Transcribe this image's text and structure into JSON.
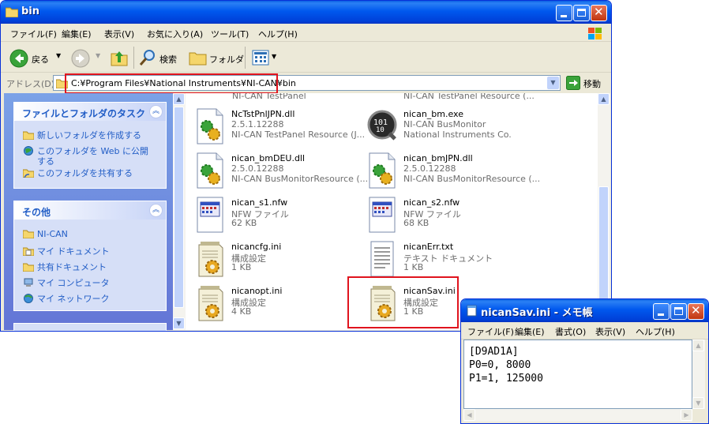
{
  "explorer": {
    "title": "bin",
    "menu": [
      "ファイル(F)",
      "編集(E)",
      "表示(V)",
      "お気に入り(A)",
      "ツール(T)",
      "ヘルプ(H)"
    ],
    "toolbar": {
      "back_label": "戻る",
      "search_label": "検索",
      "folders_label": "フォルダ"
    },
    "address": {
      "label": "アドレス(D)",
      "value": "C:¥Program Files¥National Instruments¥NI-CAN¥bin",
      "go_label": "移動"
    },
    "tasks": {
      "header": "ファイルとフォルダのタスク",
      "items": [
        "新しいフォルダを作成する",
        "このフォルダを Web に公開",
        "する",
        "このフォルダを共有する"
      ]
    },
    "others": {
      "header": "その他",
      "items": [
        "NI-CAN",
        "マイ ドキュメント",
        "共有ドキュメント",
        "マイ コンピュータ",
        "マイ ネットワーク"
      ]
    },
    "files_top_partial": [
      "NI-CAN TestPanel",
      "NI-CAN TestPanel Resource (..."
    ],
    "files": [
      {
        "name": "NcTstPnlJPN.dll",
        "line2": "2.5.1.12288",
        "line3": "NI-CAN TestPanel Resource (J...",
        "icon": "dll-gear-icon"
      },
      {
        "name": "nican_bm.exe",
        "line2": "NI-CAN BusMonitor",
        "line3": "National Instruments Co.",
        "icon": "busmonitor-app-icon"
      },
      {
        "name": "nican_bmDEU.dll",
        "line2": "2.5.0.12288",
        "line3": "NI-CAN BusMonitorResource (...",
        "icon": "dll-gear-icon"
      },
      {
        "name": "nican_bmJPN.dll",
        "line2": "2.5.0.12288",
        "line3": "NI-CAN BusMonitorResource (...",
        "icon": "dll-gear-icon"
      },
      {
        "name": "nican_s1.nfw",
        "line2": "NFW ファイル",
        "line3": "62 KB",
        "icon": "nfw-file-icon"
      },
      {
        "name": "nican_s2.nfw",
        "line2": "NFW ファイル",
        "line3": "68 KB",
        "icon": "nfw-file-icon"
      },
      {
        "name": "nicancfg.ini",
        "line2": "構成設定",
        "line3": "1 KB",
        "icon": "ini-settings-icon"
      },
      {
        "name": "nicanErr.txt",
        "line2": "テキスト ドキュメント",
        "line3": "1 KB",
        "icon": "text-document-icon"
      },
      {
        "name": "nicanopt.ini",
        "line2": "構成設定",
        "line3": "4 KB",
        "icon": "ini-settings-icon"
      },
      {
        "name": "nicanSav.ini",
        "line2": "構成設定",
        "line3": "1 KB",
        "icon": "ini-settings-icon"
      }
    ]
  },
  "notepad": {
    "title": "nicanSav.ini - メモ帳",
    "menu": [
      "ファイル(F)",
      "編集(E)",
      "書式(O)",
      "表示(V)",
      "ヘルプ(H)"
    ],
    "content": "[D9AD1A]\nP0=0, 8000\nP1=1, 125000"
  },
  "colors": {
    "highlight": "#e0141e",
    "titlebar": "#0058ee",
    "task_link": "#215dc6"
  }
}
